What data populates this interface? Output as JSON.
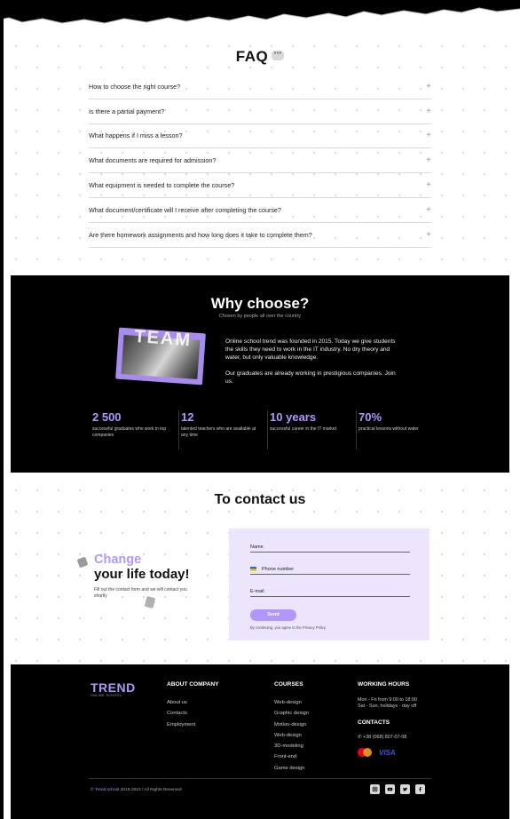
{
  "faq": {
    "title": "FAQ",
    "bubble": "•••",
    "items": [
      {
        "question": "How to choose the right course?"
      },
      {
        "question": "Is there a partial payment?"
      },
      {
        "question": "What happens if I miss a lesson?"
      },
      {
        "question": "What documents are required for admission?"
      },
      {
        "question": "What equipment is needed to complete the course?"
      },
      {
        "question": "What document/certificate will I receive after completing the course?"
      },
      {
        "question": "Are there homework assignments and how long does it take to complete them?"
      }
    ],
    "expand_symbol": "+"
  },
  "why": {
    "title": "Why choose?",
    "subtitle": "Chosen by people all over the country",
    "image_word": "TEAM",
    "paragraph_1": "Online school trend was founded in 2015. Today we give students the skills they need to work in the IT industry. No dry theory and water, but only valuable knowledge.",
    "paragraph_2": "Our graduates are already working in prestigious companies. Join us.",
    "stats": [
      {
        "value": "2 500",
        "label": "successful graduates who work in top companies"
      },
      {
        "value": "12",
        "label": "talented teachers who are available at any time"
      },
      {
        "value": "10 years",
        "label": "successful career in the IT market"
      },
      {
        "value": "70%",
        "label": "practical lessons without water"
      }
    ]
  },
  "contact": {
    "title": "To contact us",
    "heading_accent": "Change",
    "heading_main": "your life today!",
    "description": "Fill out the contact form and we will contact you shortly",
    "form": {
      "name_label": "Name",
      "phone_label": "Phone number",
      "email_label": "E-mail",
      "submit_label": "Send",
      "privacy_note": "By continuing, you agree to the Privacy Policy"
    }
  },
  "footer": {
    "logo": "TREND",
    "logo_sub": "ONLINE SCHOOL",
    "about": {
      "heading": "ABOUT COMPANY",
      "links": [
        "About us",
        "Contacts",
        "Employment"
      ]
    },
    "courses": {
      "heading": "COURSES",
      "links": [
        "Web-design",
        "Graphic design",
        "Motion-design",
        "Web-design",
        "3D-modeling",
        "Front-end",
        "Game design"
      ]
    },
    "hours": {
      "heading": "WORKING HOURS",
      "line_1": "Mon - Fri from 9:00 to 18:00",
      "line_2": "Sat - Sun, holidays - day off"
    },
    "contacts": {
      "heading": "CONTACTS",
      "phone": "+38 (068) 807-07-08"
    },
    "payments": {
      "visa": "VISA",
      "mastercard": "mastercard-logo"
    },
    "copyright_brand": "Trend school",
    "copyright_rest": " 2015-2023 / All Rights Reserved",
    "copyright_symbol": "©",
    "social_icons": [
      "instagram-icon",
      "youtube-icon",
      "twitter-icon",
      "facebook-icon"
    ]
  },
  "colors": {
    "accent": "#b197fc",
    "form_bg": "#ece5fb",
    "dark": "#000000"
  }
}
